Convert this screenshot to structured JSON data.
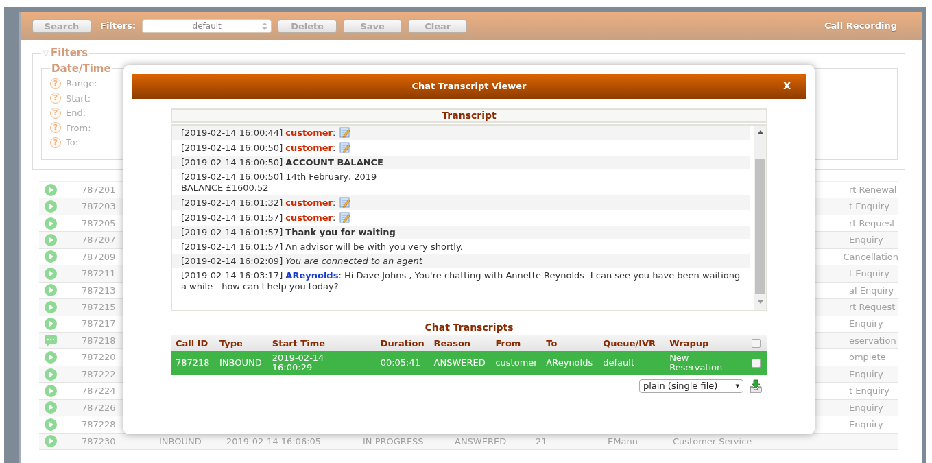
{
  "toolbar": {
    "buttons": [
      {
        "label": "Search"
      }
    ],
    "filters_label": "Filters:",
    "filter_select": {
      "value": "default"
    },
    "actions": [
      {
        "label": "Delete"
      },
      {
        "label": "Save"
      },
      {
        "label": "Clear"
      }
    ],
    "title": "Call Recording"
  },
  "filters": {
    "legend": "Filters",
    "date_time": {
      "legend": "Date/Time",
      "fields": [
        {
          "help": "?",
          "label": "Range:"
        },
        {
          "help": "?",
          "label": "Start:"
        },
        {
          "help": "?",
          "label": "End:"
        },
        {
          "help": "?",
          "label": "From:"
        },
        {
          "help": "?",
          "label": "To:"
        }
      ]
    }
  },
  "calls": [
    {
      "kind": "play",
      "call_id": "787201",
      "column_10": "rt Renewal"
    },
    {
      "kind": "play",
      "call_id": "787203",
      "column_10": "t Enquiry"
    },
    {
      "kind": "play",
      "call_id": "787205",
      "column_10": "rt Request"
    },
    {
      "kind": "play",
      "call_id": "787207",
      "column_10": "Enquiry"
    },
    {
      "kind": "play",
      "call_id": "787209",
      "column_10": "Cancellation"
    },
    {
      "kind": "play",
      "call_id": "787211",
      "column_10": "t Enquiry"
    },
    {
      "kind": "play",
      "call_id": "787213",
      "column_10": "al Enquiry"
    },
    {
      "kind": "play",
      "call_id": "787215",
      "column_10": "rt Request"
    },
    {
      "kind": "play",
      "call_id": "787217",
      "column_10": "Enquiry"
    },
    {
      "kind": "chat",
      "call_id": "787218",
      "column_10": "eservation"
    },
    {
      "kind": "play",
      "call_id": "787220",
      "column_10": "omplete"
    },
    {
      "kind": "play",
      "call_id": "787222",
      "column_10": "Enquiry"
    },
    {
      "kind": "play",
      "call_id": "787224",
      "column_10": "t Enquiry"
    },
    {
      "kind": "play",
      "call_id": "787226",
      "column_10": "Enquiry"
    },
    {
      "kind": "play",
      "call_id": "787228",
      "column_10": "Enquiry"
    },
    {
      "kind": "play",
      "call_id": "787230",
      "cells": [
        "INBOUND",
        "2019-02-14 16:06:05",
        "IN PROGRESS",
        "ANSWERED",
        "21",
        "EMann",
        "Customer Service"
      ]
    }
  ],
  "dialog": {
    "title": "Chat Transcript Viewer",
    "close": "X",
    "transcript": {
      "title": "Transcript",
      "entries": [
        {
          "kind": "customer",
          "time": "[2019-02-14 16:00:44]",
          "speaker": "customer",
          "separator": ":"
        },
        {
          "kind": "customer",
          "time": "[2019-02-14 16:00:50]",
          "speaker": "customer",
          "separator": ":"
        },
        {
          "kind": "bold",
          "time": "[2019-02-14 16:00:50]",
          "message": "ACCOUNT BALANCE"
        },
        {
          "kind": "plain",
          "time": "[2019-02-14 16:00:50]",
          "message": "14th February, 2019\nBALANCE £1600.52"
        },
        {
          "kind": "customer",
          "time": "[2019-02-14 16:01:32]",
          "speaker": "customer",
          "separator": ":"
        },
        {
          "kind": "customer",
          "time": "[2019-02-14 16:01:57]",
          "speaker": "customer",
          "separator": ":"
        },
        {
          "kind": "bold",
          "time": "[2019-02-14 16:01:57]",
          "message": "Thank you for waiting"
        },
        {
          "kind": "plain",
          "time": "[2019-02-14 16:01:57]",
          "message": "An advisor will be with you very shortly."
        },
        {
          "kind": "italic",
          "time": "[2019-02-14 16:02:09]",
          "message": "You are connected to an agent"
        },
        {
          "kind": "agent",
          "time": "[2019-02-14 16:03:17]",
          "speaker": "AReynolds",
          "separator": ":",
          "message": "Hi Dave Johns , You're chatting with Annette Reynolds -I can see you have been waitiong a while - how can I help you today?"
        }
      ]
    },
    "chats": {
      "title": "Chat Transcripts",
      "columns": [
        "Call ID",
        "Type",
        "Start Time",
        "Duration",
        "Reason",
        "From",
        "To",
        "Queue/IVR",
        "Wrapup"
      ],
      "all_checked": false,
      "rows": [
        {
          "selected": true,
          "checked": false,
          "cells": [
            "787218",
            "INBOUND",
            "2019-02-14\n16:00:29",
            "00:05:41",
            "ANSWERED",
            "customer",
            "AReynolds",
            "default",
            "New\nReservation"
          ]
        }
      ]
    },
    "format_select": {
      "value": "plain (single file)",
      "arrow": "▾"
    }
  }
}
